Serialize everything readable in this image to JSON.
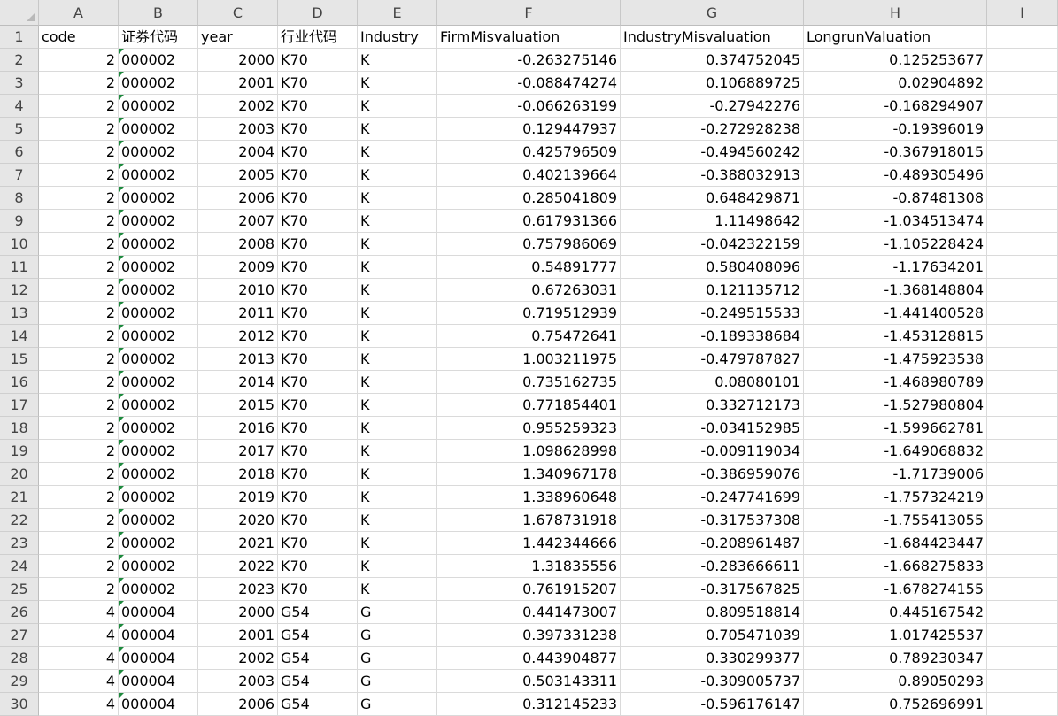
{
  "columns": [
    "A",
    "B",
    "C",
    "D",
    "E",
    "F",
    "G",
    "H",
    "I"
  ],
  "header_row": [
    "code",
    "证券代码",
    "year",
    "行业代码",
    "Industry",
    "FirmMisvaluation",
    "IndustryMisvaluation",
    "LongrunValuation",
    ""
  ],
  "rows": [
    {
      "n": "2",
      "code": "2",
      "sec": "000002",
      "year": "2000",
      "ind_code": "K70",
      "ind": "K",
      "firm": "-0.263275146",
      "industry": "0.374752045",
      "longrun": "0.125253677"
    },
    {
      "n": "3",
      "code": "2",
      "sec": "000002",
      "year": "2001",
      "ind_code": "K70",
      "ind": "K",
      "firm": "-0.088474274",
      "industry": "0.106889725",
      "longrun": "0.02904892"
    },
    {
      "n": "4",
      "code": "2",
      "sec": "000002",
      "year": "2002",
      "ind_code": "K70",
      "ind": "K",
      "firm": "-0.066263199",
      "industry": "-0.27942276",
      "longrun": "-0.168294907"
    },
    {
      "n": "5",
      "code": "2",
      "sec": "000002",
      "year": "2003",
      "ind_code": "K70",
      "ind": "K",
      "firm": "0.129447937",
      "industry": "-0.272928238",
      "longrun": "-0.19396019"
    },
    {
      "n": "6",
      "code": "2",
      "sec": "000002",
      "year": "2004",
      "ind_code": "K70",
      "ind": "K",
      "firm": "0.425796509",
      "industry": "-0.494560242",
      "longrun": "-0.367918015"
    },
    {
      "n": "7",
      "code": "2",
      "sec": "000002",
      "year": "2005",
      "ind_code": "K70",
      "ind": "K",
      "firm": "0.402139664",
      "industry": "-0.388032913",
      "longrun": "-0.489305496"
    },
    {
      "n": "8",
      "code": "2",
      "sec": "000002",
      "year": "2006",
      "ind_code": "K70",
      "ind": "K",
      "firm": "0.285041809",
      "industry": "0.648429871",
      "longrun": "-0.87481308"
    },
    {
      "n": "9",
      "code": "2",
      "sec": "000002",
      "year": "2007",
      "ind_code": "K70",
      "ind": "K",
      "firm": "0.617931366",
      "industry": "1.11498642",
      "longrun": "-1.034513474"
    },
    {
      "n": "10",
      "code": "2",
      "sec": "000002",
      "year": "2008",
      "ind_code": "K70",
      "ind": "K",
      "firm": "0.757986069",
      "industry": "-0.042322159",
      "longrun": "-1.105228424"
    },
    {
      "n": "11",
      "code": "2",
      "sec": "000002",
      "year": "2009",
      "ind_code": "K70",
      "ind": "K",
      "firm": "0.54891777",
      "industry": "0.580408096",
      "longrun": "-1.17634201"
    },
    {
      "n": "12",
      "code": "2",
      "sec": "000002",
      "year": "2010",
      "ind_code": "K70",
      "ind": "K",
      "firm": "0.67263031",
      "industry": "0.121135712",
      "longrun": "-1.368148804"
    },
    {
      "n": "13",
      "code": "2",
      "sec": "000002",
      "year": "2011",
      "ind_code": "K70",
      "ind": "K",
      "firm": "0.719512939",
      "industry": "-0.249515533",
      "longrun": "-1.441400528"
    },
    {
      "n": "14",
      "code": "2",
      "sec": "000002",
      "year": "2012",
      "ind_code": "K70",
      "ind": "K",
      "firm": "0.75472641",
      "industry": "-0.189338684",
      "longrun": "-1.453128815"
    },
    {
      "n": "15",
      "code": "2",
      "sec": "000002",
      "year": "2013",
      "ind_code": "K70",
      "ind": "K",
      "firm": "1.003211975",
      "industry": "-0.479787827",
      "longrun": "-1.475923538"
    },
    {
      "n": "16",
      "code": "2",
      "sec": "000002",
      "year": "2014",
      "ind_code": "K70",
      "ind": "K",
      "firm": "0.735162735",
      "industry": "0.08080101",
      "longrun": "-1.468980789"
    },
    {
      "n": "17",
      "code": "2",
      "sec": "000002",
      "year": "2015",
      "ind_code": "K70",
      "ind": "K",
      "firm": "0.771854401",
      "industry": "0.332712173",
      "longrun": "-1.527980804"
    },
    {
      "n": "18",
      "code": "2",
      "sec": "000002",
      "year": "2016",
      "ind_code": "K70",
      "ind": "K",
      "firm": "0.955259323",
      "industry": "-0.034152985",
      "longrun": "-1.599662781"
    },
    {
      "n": "19",
      "code": "2",
      "sec": "000002",
      "year": "2017",
      "ind_code": "K70",
      "ind": "K",
      "firm": "1.098628998",
      "industry": "-0.009119034",
      "longrun": "-1.649068832"
    },
    {
      "n": "20",
      "code": "2",
      "sec": "000002",
      "year": "2018",
      "ind_code": "K70",
      "ind": "K",
      "firm": "1.340967178",
      "industry": "-0.386959076",
      "longrun": "-1.71739006"
    },
    {
      "n": "21",
      "code": "2",
      "sec": "000002",
      "year": "2019",
      "ind_code": "K70",
      "ind": "K",
      "firm": "1.338960648",
      "industry": "-0.247741699",
      "longrun": "-1.757324219"
    },
    {
      "n": "22",
      "code": "2",
      "sec": "000002",
      "year": "2020",
      "ind_code": "K70",
      "ind": "K",
      "firm": "1.678731918",
      "industry": "-0.317537308",
      "longrun": "-1.755413055"
    },
    {
      "n": "23",
      "code": "2",
      "sec": "000002",
      "year": "2021",
      "ind_code": "K70",
      "ind": "K",
      "firm": "1.442344666",
      "industry": "-0.208961487",
      "longrun": "-1.684423447"
    },
    {
      "n": "24",
      "code": "2",
      "sec": "000002",
      "year": "2022",
      "ind_code": "K70",
      "ind": "K",
      "firm": "1.31835556",
      "industry": "-0.283666611",
      "longrun": "-1.668275833"
    },
    {
      "n": "25",
      "code": "2",
      "sec": "000002",
      "year": "2023",
      "ind_code": "K70",
      "ind": "K",
      "firm": "0.761915207",
      "industry": "-0.317567825",
      "longrun": "-1.678274155"
    },
    {
      "n": "26",
      "code": "4",
      "sec": "000004",
      "year": "2000",
      "ind_code": "G54",
      "ind": "G",
      "firm": "0.441473007",
      "industry": "0.809518814",
      "longrun": "0.445167542"
    },
    {
      "n": "27",
      "code": "4",
      "sec": "000004",
      "year": "2001",
      "ind_code": "G54",
      "ind": "G",
      "firm": "0.397331238",
      "industry": "0.705471039",
      "longrun": "1.017425537"
    },
    {
      "n": "28",
      "code": "4",
      "sec": "000004",
      "year": "2002",
      "ind_code": "G54",
      "ind": "G",
      "firm": "0.443904877",
      "industry": "0.330299377",
      "longrun": "0.789230347"
    },
    {
      "n": "29",
      "code": "4",
      "sec": "000004",
      "year": "2003",
      "ind_code": "G54",
      "ind": "G",
      "firm": "0.503143311",
      "industry": "-0.309005737",
      "longrun": "0.89050293"
    },
    {
      "n": "30",
      "code": "4",
      "sec": "000004",
      "year": "2006",
      "ind_code": "G54",
      "ind": "G",
      "firm": "0.312145233",
      "industry": "-0.596176147",
      "longrun": "0.752696991"
    }
  ]
}
